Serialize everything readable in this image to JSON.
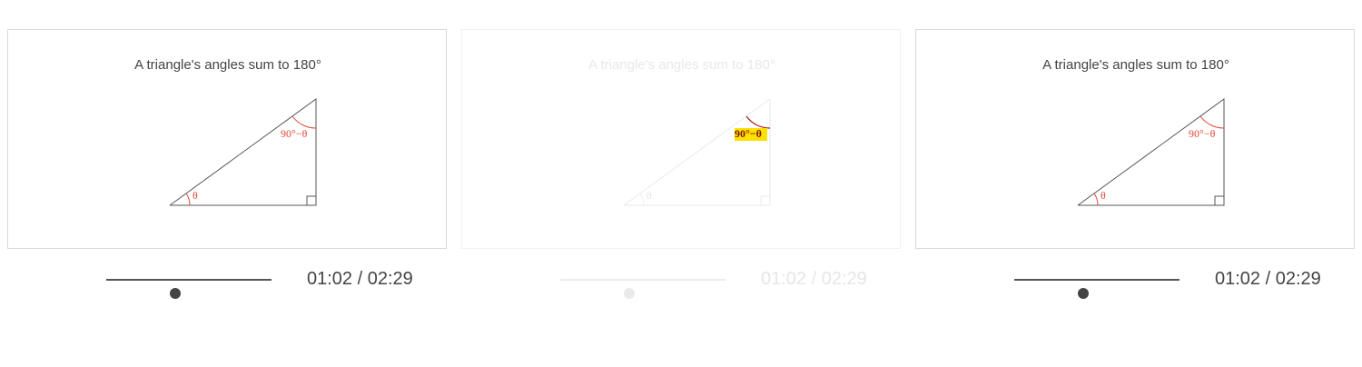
{
  "frames": [
    {
      "title": "A triangle's angles sum to 180°",
      "angle_theta": "θ",
      "angle_complement": "90°−θ",
      "current_time": "01:02",
      "total_time": "02:29",
      "time_display": "01:02 / 02:29",
      "progress_fraction": 0.416,
      "state": "normal"
    },
    {
      "title": "A triangle's angles sum to 180°",
      "angle_theta": "θ",
      "angle_complement": "90°−θ",
      "current_time": "01:02",
      "total_time": "02:29",
      "time_display": "01:02 / 02:29",
      "progress_fraction": 0.416,
      "state": "faded-highlight-complement"
    },
    {
      "title": "A triangle's angles sum to 180°",
      "angle_theta": "θ",
      "angle_complement": "90°−θ",
      "current_time": "01:02",
      "total_time": "02:29",
      "time_display": "01:02 / 02:29",
      "progress_fraction": 0.416,
      "state": "normal"
    }
  ],
  "colors": {
    "angle_accent": "#e0483a",
    "highlight": "#ffe100",
    "text": "#444444"
  }
}
